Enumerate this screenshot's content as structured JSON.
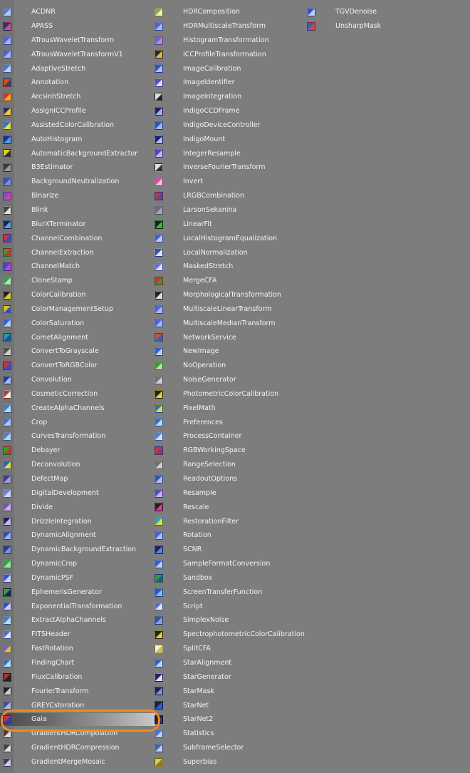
{
  "columns": [
    [
      {
        "label": "ACDNR",
        "icon": "acdnr-icon",
        "c1": "#5b7bc7",
        "c2": "#b9c9ef"
      },
      {
        "label": "APASS",
        "icon": "apass-icon",
        "c1": "#2a2f7a",
        "c2": "#d94d7c"
      },
      {
        "label": "ATrousWaveletTransform",
        "icon": "atrous-wavelet-icon",
        "c1": "#4a66d0",
        "c2": "#a6b6f2"
      },
      {
        "label": "ATrousWaveletTransformV1",
        "icon": "atrous-wavelet-v1-icon",
        "c1": "#4a66d0",
        "c2": "#a6b6f2"
      },
      {
        "label": "AdaptiveStretch",
        "icon": "adaptive-stretch-icon",
        "c1": "#4a76c8",
        "c2": "#c0d0f0"
      },
      {
        "label": "Annotation",
        "icon": "annotation-icon",
        "c1": "#d8501e",
        "c2": "#3a3a80"
      },
      {
        "label": "ArcsinhStretch",
        "icon": "arcsinh-stretch-icon",
        "c1": "#c83a2a",
        "c2": "#f0b030"
      },
      {
        "label": "AssignICCProfile",
        "icon": "assign-icc-icon",
        "c1": "#2a2a6a",
        "c2": "#e8d040"
      },
      {
        "label": "AssistedColorCalibration",
        "icon": "assisted-color-calibration-icon",
        "c1": "#3a70c0",
        "c2": "#e0e040"
      },
      {
        "label": "AutoHistogram",
        "icon": "auto-histogram-icon",
        "c1": "#2a2a8a",
        "c2": "#50a0e0"
      },
      {
        "label": "AutomaticBackgroundExtractor",
        "icon": "abe-icon",
        "c1": "#e0d020",
        "c2": "#303030"
      },
      {
        "label": "B3Estimator",
        "icon": "b3-estimator-icon",
        "c1": "#3a3a3a",
        "c2": "#9a9a9a"
      },
      {
        "label": "BackgroundNeutralization",
        "icon": "background-neutralization-icon",
        "c1": "#3a50b0",
        "c2": "#8090d0"
      },
      {
        "label": "Binarize",
        "icon": "binarize-icon",
        "c1": "#6a5ad0",
        "c2": "#d040a0"
      },
      {
        "label": "Blink",
        "icon": "blink-icon",
        "c1": "#404040",
        "c2": "#e0e0e0"
      },
      {
        "label": "BlurXTerminator",
        "icon": "blurx-icon",
        "c1": "#202050",
        "c2": "#60a0e0"
      },
      {
        "label": "ChannelCombination",
        "icon": "channel-combination-icon",
        "c1": "#d03030",
        "c2": "#3050d0"
      },
      {
        "label": "ChannelExtraction",
        "icon": "channel-extraction-icon",
        "c1": "#30a030",
        "c2": "#d03030"
      },
      {
        "label": "ChannelMatch",
        "icon": "channel-match-icon",
        "c1": "#3050d0",
        "c2": "#d040c0"
      },
      {
        "label": "CloneStamp",
        "icon": "clone-stamp-icon",
        "c1": "#30a040",
        "c2": "#c0e0c0"
      },
      {
        "label": "ColorCalibration",
        "icon": "color-calibration-icon",
        "c1": "#202020",
        "c2": "#d0d030"
      },
      {
        "label": "ColorManagementSetup",
        "icon": "color-management-icon",
        "c1": "#e0c020",
        "c2": "#3050c0"
      },
      {
        "label": "ColorSaturation",
        "icon": "color-saturation-icon",
        "c1": "#3060d0",
        "c2": "#c0d0f0"
      },
      {
        "label": "CometAlignment",
        "icon": "comet-alignment-icon",
        "c1": "#20a0a0",
        "c2": "#2050a0"
      },
      {
        "label": "ConvertToGrayscale",
        "icon": "convert-grayscale-icon",
        "c1": "#505050",
        "c2": "#d0d0d0"
      },
      {
        "label": "ConvertToRGBColor",
        "icon": "convert-rgb-icon",
        "c1": "#d03030",
        "c2": "#3050d0"
      },
      {
        "label": "Convolution",
        "icon": "convolution-icon",
        "c1": "#2a3a8a",
        "c2": "#a0c0f0"
      },
      {
        "label": "CosmeticCorrection",
        "icon": "cosmetic-correction-icon",
        "c1": "#b04040",
        "c2": "#f0f0f0"
      },
      {
        "label": "CreateAlphaChannels",
        "icon": "create-alpha-icon",
        "c1": "#3a80c0",
        "c2": "#c0d8f0"
      },
      {
        "label": "Crop",
        "icon": "crop-icon",
        "c1": "#4a70c0",
        "c2": "#b0c8f0"
      },
      {
        "label": "CurvesTransformation",
        "icon": "curves-icon",
        "c1": "#5080c0",
        "c2": "#c0d0f0"
      },
      {
        "label": "Debayer",
        "icon": "debayer-icon",
        "c1": "#30a030",
        "c2": "#d03030"
      },
      {
        "label": "Deconvolution",
        "icon": "deconvolution-icon",
        "c1": "#2a60c0",
        "c2": "#e0e040"
      },
      {
        "label": "DefectMap",
        "icon": "defect-map-icon",
        "c1": "#404080",
        "c2": "#a0a0d0"
      },
      {
        "label": "DigitalDevelopment",
        "icon": "digital-development-icon",
        "c1": "#7080d0",
        "c2": "#d0d8f0"
      },
      {
        "label": "Divide",
        "icon": "divide-icon",
        "c1": "#6a5ab0",
        "c2": "#d0b0e0"
      },
      {
        "label": "DrizzleIntegration",
        "icon": "drizzle-integration-icon",
        "c1": "#202050",
        "c2": "#c0c0f0"
      },
      {
        "label": "DynamicAlignment",
        "icon": "dynamic-alignment-icon",
        "c1": "#3050b0",
        "c2": "#a0b0e0"
      },
      {
        "label": "DynamicBackgroundExtraction",
        "icon": "dbe-icon",
        "c1": "#2a3a8a",
        "c2": "#8090d0"
      },
      {
        "label": "DynamicCrop",
        "icon": "dynamic-crop-icon",
        "c1": "#30a050",
        "c2": "#a0e0a0"
      },
      {
        "label": "DynamicPSF",
        "icon": "dynamic-psf-icon",
        "c1": "#4050d0",
        "c2": "#d0d8f0"
      },
      {
        "label": "EphemerisGenerator",
        "icon": "ephemeris-generator-icon",
        "c1": "#30a040",
        "c2": "#202060"
      },
      {
        "label": "ExponentialTransformation",
        "icon": "exponential-transformation-icon",
        "c1": "#3050c0",
        "c2": "#d0d0f0"
      },
      {
        "label": "ExtractAlphaChannels",
        "icon": "extract-alpha-icon",
        "c1": "#3a80c0",
        "c2": "#c0d8f0"
      },
      {
        "label": "FITSHeader",
        "icon": "fits-header-icon",
        "c1": "#5070c0",
        "c2": "#e0e8f8"
      },
      {
        "label": "FastRotation",
        "icon": "fast-rotation-icon",
        "c1": "#7060d0",
        "c2": "#e0c040"
      },
      {
        "label": "FindingChart",
        "icon": "finding-chart-icon",
        "c1": "#3070c0",
        "c2": "#c0d8f0"
      },
      {
        "label": "FluxCalibration",
        "icon": "flux-calibration-icon",
        "c1": "#b03030",
        "c2": "#202020"
      },
      {
        "label": "FourierTransform",
        "icon": "fourier-transform-icon",
        "c1": "#202020",
        "c2": "#d0d0d0"
      },
      {
        "label": "GREYCstoration",
        "icon": "greycstoration-icon",
        "c1": "#405090",
        "c2": "#b0b8d8"
      },
      {
        "label": "Gaia",
        "icon": "gaia-icon",
        "c1": "#c03060",
        "c2": "#3040a0",
        "selected": true
      },
      {
        "label": "GradientHDRComposition",
        "icon": "gradient-hdr-composition-icon",
        "c1": "#404040",
        "c2": "#e0e0e0"
      },
      {
        "label": "GradientHDRCompression",
        "icon": "gradient-hdr-compression-icon",
        "c1": "#404040",
        "c2": "#e0e0e0"
      },
      {
        "label": "GradientMergeMosaic",
        "icon": "gradient-merge-mosaic-icon",
        "c1": "#3a3a70",
        "c2": "#d0d0d0"
      }
    ],
    [
      {
        "label": "HDRComposition",
        "icon": "hdr-composition-icon",
        "c1": "#a0a040",
        "c2": "#f0f0c0"
      },
      {
        "label": "HDRMultiscaleTransform",
        "icon": "hdr-multiscale-icon",
        "c1": "#4a66d0",
        "c2": "#a6b6f2"
      },
      {
        "label": "HistogramTransformation",
        "icon": "histogram-transformation-icon",
        "c1": "#5a70d0",
        "c2": "#d080c0"
      },
      {
        "label": "ICCProfileTransformation",
        "icon": "icc-profile-transformation-icon",
        "c1": "#202060",
        "c2": "#e0c020"
      },
      {
        "label": "ImageCalibration",
        "icon": "image-calibration-icon",
        "c1": "#3050c0",
        "c2": "#b0c0f0"
      },
      {
        "label": "ImageIdentifier",
        "icon": "image-identifier-icon",
        "c1": "#5050c0",
        "c2": "#e0e0f8"
      },
      {
        "label": "ImageIntegration",
        "icon": "image-integration-icon",
        "c1": "#e0e0e0",
        "c2": "#202020"
      },
      {
        "label": "IndigoCCDFrame",
        "icon": "indigo-ccd-icon",
        "c1": "#202060",
        "c2": "#a0b0f0"
      },
      {
        "label": "IndigoDeviceController",
        "icon": "indigo-device-icon",
        "c1": "#3050c0",
        "c2": "#a0b8f0"
      },
      {
        "label": "IndigoMount",
        "icon": "indigo-mount-icon",
        "c1": "#202070",
        "c2": "#b0c0f0"
      },
      {
        "label": "IntegerResample",
        "icon": "integer-resample-icon",
        "c1": "#5040c0",
        "c2": "#d0b0f0"
      },
      {
        "label": "InverseFourierTransform",
        "icon": "inverse-fourier-icon",
        "c1": "#e0e0e0",
        "c2": "#303030"
      },
      {
        "label": "Invert",
        "icon": "invert-icon",
        "c1": "#d050a0",
        "c2": "#f0c0e0"
      },
      {
        "label": "LRGBCombination",
        "icon": "lrgb-combination-icon",
        "c1": "#d03030",
        "c2": "#3050d0"
      },
      {
        "label": "LarsonSekanina",
        "icon": "larson-sekanina-icon",
        "c1": "#707070",
        "c2": "#a0a0d0"
      },
      {
        "label": "LinearFit",
        "icon": "linear-fit-icon",
        "c1": "#202020",
        "c2": "#30c030"
      },
      {
        "label": "LocalHistogramEqualization",
        "icon": "local-histogram-icon",
        "c1": "#4060d0",
        "c2": "#c0d0f0"
      },
      {
        "label": "LocalNormalization",
        "icon": "local-normalization-icon",
        "c1": "#3050c0",
        "c2": "#e0e8f8"
      },
      {
        "label": "MaskedStretch",
        "icon": "masked-stretch-icon",
        "c1": "#6a70d0",
        "c2": "#e0e0f8"
      },
      {
        "label": "MergeCFA",
        "icon": "merge-cfa-icon",
        "c1": "#d03030",
        "c2": "#30a030"
      },
      {
        "label": "MorphologicalTransformation",
        "icon": "morphological-transformation-icon",
        "c1": "#202020",
        "c2": "#e0e0e0"
      },
      {
        "label": "MultiscaleLinearTransform",
        "icon": "multiscale-linear-icon",
        "c1": "#4a66d0",
        "c2": "#a6b6f2"
      },
      {
        "label": "MultiscaleMedianTransform",
        "icon": "multiscale-median-icon",
        "c1": "#4a66d0",
        "c2": "#a6b6f2"
      },
      {
        "label": "NetworkService",
        "icon": "network-service-icon",
        "c1": "#d05030",
        "c2": "#3060c0"
      },
      {
        "label": "NewImage",
        "icon": "new-image-icon",
        "c1": "#3060d0",
        "c2": "#c0d0f0"
      },
      {
        "label": "NoOperation",
        "icon": "no-operation-icon",
        "c1": "#30a030",
        "c2": "#c0e0a0"
      },
      {
        "label": "NoiseGenerator",
        "icon": "noise-generator-icon",
        "c1": "#707070",
        "c2": "#d0d0d0"
      },
      {
        "label": "PhotometricColorCalibration",
        "icon": "photometric-color-calibration-icon",
        "c1": "#202020",
        "c2": "#e0d030"
      },
      {
        "label": "PixelMath",
        "icon": "pixel-math-icon",
        "c1": "#3070c0",
        "c2": "#e0e040"
      },
      {
        "label": "Preferences",
        "icon": "preferences-icon",
        "c1": "#3070d0",
        "c2": "#c0d8f0"
      },
      {
        "label": "ProcessContainer",
        "icon": "process-container-icon",
        "c1": "#5080d0",
        "c2": "#d0e0f8"
      },
      {
        "label": "RGBWorkingSpace",
        "icon": "rgb-working-space-icon",
        "c1": "#d03030",
        "c2": "#3050d0"
      },
      {
        "label": "RangeSelection",
        "icon": "range-selection-icon",
        "c1": "#707070",
        "c2": "#d0d0d0"
      },
      {
        "label": "ReadoutOptions",
        "icon": "readout-options-icon",
        "c1": "#3050c0",
        "c2": "#b0c0f0"
      },
      {
        "label": "Resample",
        "icon": "resample-icon",
        "c1": "#5050c0",
        "c2": "#d0b0f0"
      },
      {
        "label": "Rescale",
        "icon": "rescale-icon",
        "c1": "#202020",
        "c2": "#d040a0"
      },
      {
        "label": "RestorationFilter",
        "icon": "restoration-filter-icon",
        "c1": "#30a0b0",
        "c2": "#e0e040"
      },
      {
        "label": "Rotation",
        "icon": "rotation-icon",
        "c1": "#4a60d0",
        "c2": "#b0c0f0"
      },
      {
        "label": "SCNR",
        "icon": "scnr-icon",
        "c1": "#202060",
        "c2": "#6080e0"
      },
      {
        "label": "SampleFormatConversion",
        "icon": "sample-format-conversion-icon",
        "c1": "#3060d0",
        "c2": "#c0d0f0"
      },
      {
        "label": "Sandbox",
        "icon": "sandbox-icon",
        "c1": "#30a030",
        "c2": "#2050c0"
      },
      {
        "label": "ScreenTransferFunction",
        "icon": "screen-transfer-function-icon",
        "c1": "#3050c0",
        "c2": "#80c0f0"
      },
      {
        "label": "Script",
        "icon": "script-icon",
        "c1": "#5070d0",
        "c2": "#e0e8f8"
      },
      {
        "label": "SimplexNoise",
        "icon": "simplex-noise-icon",
        "c1": "#3050b0",
        "c2": "#90a0d0"
      },
      {
        "label": "SpectrophotometricColorCalibration",
        "icon": "spcc-icon",
        "c1": "#202020",
        "c2": "#e0d030"
      },
      {
        "label": "SplitCFA",
        "icon": "split-cfa-icon",
        "c1": "#f0f0f0",
        "c2": "#e0c020"
      },
      {
        "label": "StarAlignment",
        "icon": "star-alignment-icon",
        "c1": "#3060c0",
        "c2": "#c0d8f0"
      },
      {
        "label": "StarGenerator",
        "icon": "star-generator-icon",
        "c1": "#202070",
        "c2": "#e0e0f8"
      },
      {
        "label": "StarMask",
        "icon": "star-mask-icon",
        "c1": "#202050",
        "c2": "#8090d0"
      },
      {
        "label": "StarNet",
        "icon": "starnet-icon",
        "c1": "#202050",
        "c2": "#3060c0"
      },
      {
        "label": "StarNet2",
        "icon": "starnet2-icon",
        "c1": "#202020",
        "c2": "#303070"
      },
      {
        "label": "Statistics",
        "icon": "statistics-icon",
        "c1": "#5070d0",
        "c2": "#c0d0f0"
      },
      {
        "label": "SubframeSelector",
        "icon": "subframe-selector-icon",
        "c1": "#4060b0",
        "c2": "#c0d0f0"
      },
      {
        "label": "Superbias",
        "icon": "superbias-icon",
        "c1": "#e0d040",
        "c2": "#8a7a20"
      }
    ],
    [
      {
        "label": "TGVDenoise",
        "icon": "tgv-denoise-icon",
        "c1": "#3050d0",
        "c2": "#c0d0f0"
      },
      {
        "label": "UnsharpMask",
        "icon": "unsharp-mask-icon",
        "c1": "#3060c0",
        "c2": "#e04040"
      }
    ]
  ],
  "highlight_color": "#f08a24"
}
